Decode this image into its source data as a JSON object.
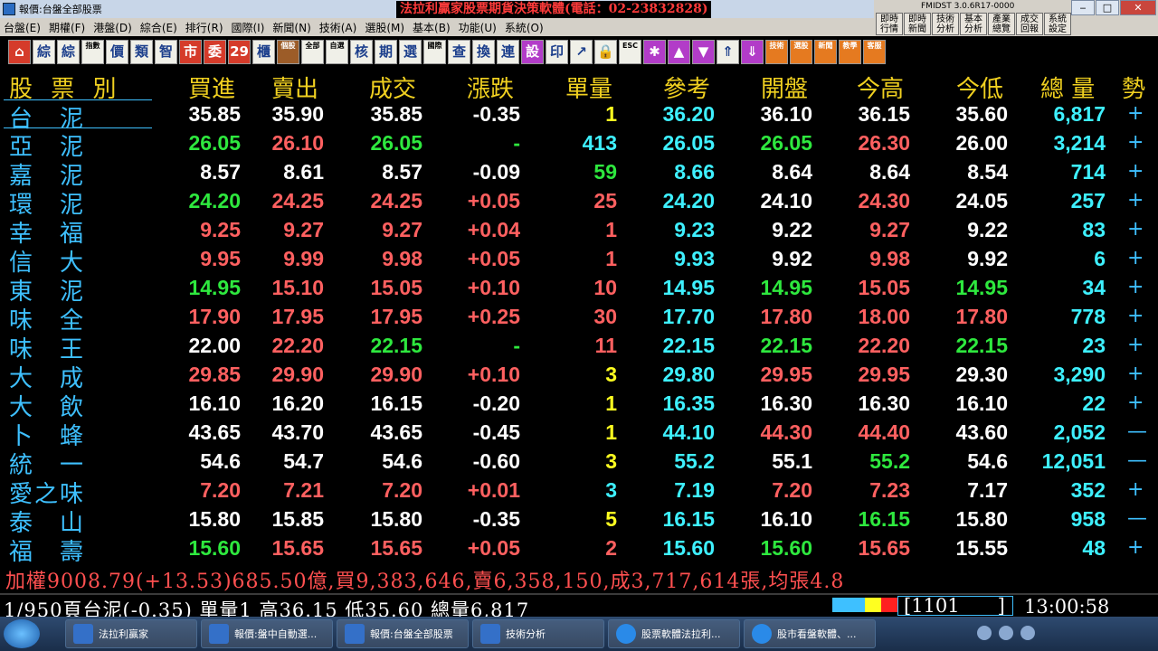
{
  "window": {
    "title": "報價:台盤全部股票",
    "app_title": "法拉利贏家股票期貨決策軟體(電話：02-23832828)"
  },
  "menu": [
    "台盤(E)",
    "期權(F)",
    "港盤(D)",
    "綜合(E)",
    "排行(R)",
    "國際(I)",
    "新聞(N)",
    "技術(A)",
    "選股(M)",
    "基本(B)",
    "功能(U)",
    "系統(O)"
  ],
  "right_panel": {
    "version": "FMIDST 3.0.6R17-0000",
    "buttons": [
      "即時行情",
      "即時新聞",
      "技術分析",
      "基本分析",
      "產業總覽",
      "成交回報",
      "系統設定"
    ]
  },
  "toolbar": {
    "buttons": [
      {
        "label": "⌂",
        "icon": "home-icon",
        "style": "red"
      },
      {
        "label": "綜",
        "icon": "overview-icon",
        "style": "blue"
      },
      {
        "label": "綜",
        "icon": "overview2-icon",
        "style": "blue"
      },
      {
        "label": "指數",
        "icon": "index-icon",
        "style": "small"
      },
      {
        "label": "價",
        "icon": "price-icon",
        "style": "blue"
      },
      {
        "label": "類",
        "icon": "category-icon",
        "style": "blue"
      },
      {
        "label": "智",
        "icon": "smart-icon",
        "style": "blue"
      },
      {
        "label": "市",
        "icon": "market-icon",
        "style": "red"
      },
      {
        "label": "委",
        "icon": "order-icon",
        "style": "red"
      },
      {
        "label": "29",
        "icon": "number29-icon",
        "style": "red"
      },
      {
        "label": "櫃",
        "icon": "otc-icon",
        "style": "blue"
      },
      {
        "label": "個股",
        "icon": "stock-icon",
        "style": "brown"
      },
      {
        "label": "全部",
        "icon": "all-icon",
        "style": "small"
      },
      {
        "label": "自選",
        "icon": "watchlist-icon",
        "style": "small"
      },
      {
        "label": "核",
        "icon": "core-icon",
        "style": "blue"
      },
      {
        "label": "期",
        "icon": "futures-icon",
        "style": "blue"
      },
      {
        "label": "選",
        "icon": "options-icon",
        "style": "blue"
      },
      {
        "label": "國際",
        "icon": "global-icon",
        "style": "small"
      },
      {
        "label": "查",
        "icon": "query-icon",
        "style": "blue"
      },
      {
        "label": "換",
        "icon": "switch-icon",
        "style": "blue"
      },
      {
        "label": "連",
        "icon": "link-icon",
        "style": "blue"
      },
      {
        "label": "設定",
        "icon": "settings-icon",
        "style": "purple"
      },
      {
        "label": "印",
        "icon": "print-icon",
        "style": "blue"
      },
      {
        "label": "↗",
        "icon": "export-icon",
        "style": "blue"
      },
      {
        "label": "🔒",
        "icon": "lock-icon",
        "style": "blue"
      },
      {
        "label": "ESC",
        "icon": "escape-icon",
        "style": "small"
      },
      {
        "label": "✱",
        "icon": "asterisk-icon",
        "style": "purple"
      },
      {
        "label": "▲",
        "icon": "up-arrow-icon",
        "style": "purple"
      },
      {
        "label": "▼",
        "icon": "down-arrow-icon",
        "style": "purple"
      },
      {
        "label": "⇑",
        "icon": "page-up-icon",
        "style": "blue"
      },
      {
        "label": "⇓",
        "icon": "page-down-icon",
        "style": "purple"
      },
      {
        "label": "技術",
        "icon": "technical-icon",
        "style": "orange"
      },
      {
        "label": "選股",
        "icon": "screen-icon",
        "style": "orange"
      },
      {
        "label": "新聞",
        "icon": "news-icon",
        "style": "orange"
      },
      {
        "label": "教學",
        "icon": "tutorial-icon",
        "style": "orange"
      },
      {
        "label": "客服",
        "icon": "support-icon",
        "style": "orange"
      }
    ]
  },
  "columns": [
    "股 票 別",
    "買進",
    "賣出",
    "成交",
    "漲跌",
    "單量",
    "參考",
    "開盤",
    "今高",
    "今低",
    "總 量",
    "勢"
  ],
  "rows": [
    {
      "name": "台　泥",
      "buy": "35.85",
      "sell": "35.90",
      "deal": "35.85",
      "chg": "-0.35",
      "vol": "1",
      "ref": "36.20",
      "open": "36.10",
      "high": "36.15",
      "low": "35.60",
      "total": "6,817",
      "trend": "+",
      "colors": {
        "buy": "white",
        "sell": "white",
        "deal": "white",
        "chg": "white",
        "vol": "yellow",
        "ref": "cyan",
        "open": "white",
        "high": "white",
        "low": "white",
        "total": "cyan"
      }
    },
    {
      "name": "亞　泥",
      "buy": "26.05",
      "sell": "26.10",
      "deal": "26.05",
      "chg": "-",
      "vol": "413",
      "ref": "26.05",
      "open": "26.05",
      "high": "26.30",
      "low": "26.00",
      "total": "3,214",
      "trend": "+",
      "colors": {
        "buy": "green",
        "sell": "red",
        "deal": "green",
        "chg": "green",
        "vol": "cyan",
        "ref": "cyan",
        "open": "green",
        "high": "red",
        "low": "white",
        "total": "cyan"
      }
    },
    {
      "name": "嘉　泥",
      "buy": "8.57",
      "sell": "8.61",
      "deal": "8.57",
      "chg": "-0.09",
      "vol": "59",
      "ref": "8.66",
      "open": "8.64",
      "high": "8.64",
      "low": "8.54",
      "total": "714",
      "trend": "+",
      "colors": {
        "buy": "white",
        "sell": "white",
        "deal": "white",
        "chg": "white",
        "vol": "green",
        "ref": "cyan",
        "open": "white",
        "high": "white",
        "low": "white",
        "total": "cyan"
      }
    },
    {
      "name": "環　泥",
      "buy": "24.20",
      "sell": "24.25",
      "deal": "24.25",
      "chg": "+0.05",
      "vol": "25",
      "ref": "24.20",
      "open": "24.10",
      "high": "24.30",
      "low": "24.05",
      "total": "257",
      "trend": "+",
      "colors": {
        "buy": "green",
        "sell": "red",
        "deal": "red",
        "chg": "red",
        "vol": "red",
        "ref": "cyan",
        "open": "white",
        "high": "red",
        "low": "white",
        "total": "cyan"
      }
    },
    {
      "name": "幸　福",
      "buy": "9.25",
      "sell": "9.27",
      "deal": "9.27",
      "chg": "+0.04",
      "vol": "1",
      "ref": "9.23",
      "open": "9.22",
      "high": "9.27",
      "low": "9.22",
      "total": "83",
      "trend": "+",
      "colors": {
        "buy": "red",
        "sell": "red",
        "deal": "red",
        "chg": "red",
        "vol": "red",
        "ref": "cyan",
        "open": "white",
        "high": "red",
        "low": "white",
        "total": "cyan"
      }
    },
    {
      "name": "信　大",
      "buy": "9.95",
      "sell": "9.99",
      "deal": "9.98",
      "chg": "+0.05",
      "vol": "1",
      "ref": "9.93",
      "open": "9.92",
      "high": "9.98",
      "low": "9.92",
      "total": "6",
      "trend": "+",
      "colors": {
        "buy": "red",
        "sell": "red",
        "deal": "red",
        "chg": "red",
        "vol": "red",
        "ref": "cyan",
        "open": "white",
        "high": "red",
        "low": "white",
        "total": "cyan"
      }
    },
    {
      "name": "東　泥",
      "buy": "14.95",
      "sell": "15.10",
      "deal": "15.05",
      "chg": "+0.10",
      "vol": "10",
      "ref": "14.95",
      "open": "14.95",
      "high": "15.05",
      "low": "14.95",
      "total": "34",
      "trend": "+",
      "colors": {
        "buy": "green",
        "sell": "red",
        "deal": "red",
        "chg": "red",
        "vol": "red",
        "ref": "cyan",
        "open": "green",
        "high": "red",
        "low": "green",
        "total": "cyan"
      }
    },
    {
      "name": "味　全",
      "buy": "17.90",
      "sell": "17.95",
      "deal": "17.95",
      "chg": "+0.25",
      "vol": "30",
      "ref": "17.70",
      "open": "17.80",
      "high": "18.00",
      "low": "17.80",
      "total": "778",
      "trend": "+",
      "colors": {
        "buy": "red",
        "sell": "red",
        "deal": "red",
        "chg": "red",
        "vol": "red",
        "ref": "cyan",
        "open": "red",
        "high": "red",
        "low": "red",
        "total": "cyan"
      }
    },
    {
      "name": "味　王",
      "buy": "22.00",
      "sell": "22.20",
      "deal": "22.15",
      "chg": "-",
      "vol": "11",
      "ref": "22.15",
      "open": "22.15",
      "high": "22.20",
      "low": "22.15",
      "total": "23",
      "trend": "+",
      "colors": {
        "buy": "white",
        "sell": "red",
        "deal": "green",
        "chg": "green",
        "vol": "red",
        "ref": "cyan",
        "open": "green",
        "high": "red",
        "low": "green",
        "total": "cyan"
      }
    },
    {
      "name": "大　成",
      "buy": "29.85",
      "sell": "29.90",
      "deal": "29.90",
      "chg": "+0.10",
      "vol": "3",
      "ref": "29.80",
      "open": "29.95",
      "high": "29.95",
      "low": "29.30",
      "total": "3,290",
      "trend": "+",
      "colors": {
        "buy": "red",
        "sell": "red",
        "deal": "red",
        "chg": "red",
        "vol": "yellow",
        "ref": "cyan",
        "open": "red",
        "high": "red",
        "low": "white",
        "total": "cyan"
      }
    },
    {
      "name": "大　飲",
      "buy": "16.10",
      "sell": "16.20",
      "deal": "16.15",
      "chg": "-0.20",
      "vol": "1",
      "ref": "16.35",
      "open": "16.30",
      "high": "16.30",
      "low": "16.10",
      "total": "22",
      "trend": "+",
      "colors": {
        "buy": "white",
        "sell": "white",
        "deal": "white",
        "chg": "white",
        "vol": "yellow",
        "ref": "cyan",
        "open": "white",
        "high": "white",
        "low": "white",
        "total": "cyan"
      }
    },
    {
      "name": "卜　蜂",
      "buy": "43.65",
      "sell": "43.70",
      "deal": "43.65",
      "chg": "-0.45",
      "vol": "1",
      "ref": "44.10",
      "open": "44.30",
      "high": "44.40",
      "low": "43.60",
      "total": "2,052",
      "trend": "—",
      "colors": {
        "buy": "white",
        "sell": "white",
        "deal": "white",
        "chg": "white",
        "vol": "yellow",
        "ref": "cyan",
        "open": "red",
        "high": "red",
        "low": "white",
        "total": "cyan"
      }
    },
    {
      "name": "統　一",
      "buy": "54.6",
      "sell": "54.7",
      "deal": "54.6",
      "chg": "-0.60",
      "vol": "3",
      "ref": "55.2",
      "open": "55.1",
      "high": "55.2",
      "low": "54.6",
      "total": "12,051",
      "trend": "—",
      "colors": {
        "buy": "white",
        "sell": "white",
        "deal": "white",
        "chg": "white",
        "vol": "yellow",
        "ref": "cyan",
        "open": "white",
        "high": "green",
        "low": "white",
        "total": "cyan"
      }
    },
    {
      "name": "愛之味",
      "buy": "7.20",
      "sell": "7.21",
      "deal": "7.20",
      "chg": "+0.01",
      "vol": "3",
      "ref": "7.19",
      "open": "7.20",
      "high": "7.23",
      "low": "7.17",
      "total": "352",
      "trend": "+",
      "colors": {
        "buy": "red",
        "sell": "red",
        "deal": "red",
        "chg": "red",
        "vol": "cyan",
        "ref": "cyan",
        "open": "red",
        "high": "red",
        "low": "white",
        "total": "cyan"
      }
    },
    {
      "name": "泰　山",
      "buy": "15.80",
      "sell": "15.85",
      "deal": "15.80",
      "chg": "-0.35",
      "vol": "5",
      "ref": "16.15",
      "open": "16.10",
      "high": "16.15",
      "low": "15.80",
      "total": "958",
      "trend": "—",
      "colors": {
        "buy": "white",
        "sell": "white",
        "deal": "white",
        "chg": "white",
        "vol": "yellow",
        "ref": "cyan",
        "open": "white",
        "high": "green",
        "low": "white",
        "total": "cyan"
      }
    },
    {
      "name": "福　壽",
      "buy": "15.60",
      "sell": "15.65",
      "deal": "15.65",
      "chg": "+0.05",
      "vol": "2",
      "ref": "15.60",
      "open": "15.60",
      "high": "15.65",
      "low": "15.55",
      "total": "48",
      "trend": "+",
      "colors": {
        "buy": "green",
        "sell": "red",
        "deal": "red",
        "chg": "red",
        "vol": "red",
        "ref": "cyan",
        "open": "green",
        "high": "red",
        "low": "white",
        "total": "cyan"
      }
    }
  ],
  "summary": "加權9008.79(+13.53)685.50億,買9,383,646,賣6,358,150,成3,717,614張,均張4.8",
  "status": {
    "text": "1/950頁台泥(-0.35) 單量1 高36.15 低35.60 總量6,817",
    "code": "[1101　　]",
    "time": "13:00:58"
  },
  "taskbar": {
    "items": [
      {
        "label": "法拉利贏家",
        "icon": "app-icon"
      },
      {
        "label": "報價:盤中自動選...",
        "icon": "quote-icon"
      },
      {
        "label": "報價:台盤全部股票",
        "icon": "quote-icon"
      },
      {
        "label": "技術分析",
        "icon": "chart-icon"
      },
      {
        "label": "股票軟體法拉利...",
        "icon": "ie-icon"
      },
      {
        "label": "股市看盤軟體、...",
        "icon": "ie-icon"
      }
    ]
  }
}
